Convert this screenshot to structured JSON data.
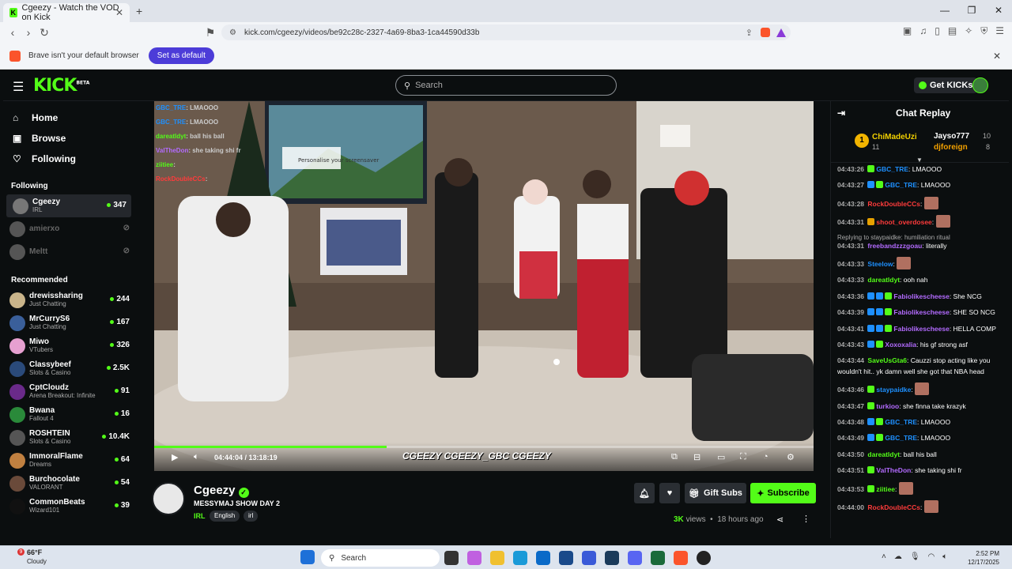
{
  "browser": {
    "tab_title": "Cgeezy - Watch the VOD on Kick",
    "url": "kick.com/cgeezy/videos/be92c28c-2327-4a69-8ba3-1ca44590d33b",
    "infobar_text": "Brave isn't your default browser",
    "infobar_button": "Set as default"
  },
  "header": {
    "logo": "KICK",
    "logo_badge": "BETA",
    "search_placeholder": "Search",
    "get_kicks": "Get KICKs"
  },
  "sidebar": {
    "nav": [
      {
        "label": "Home",
        "icon": "home-icon"
      },
      {
        "label": "Browse",
        "icon": "browse-icon"
      },
      {
        "label": "Following",
        "icon": "heart-icon"
      }
    ],
    "following_title": "Following",
    "following": [
      {
        "name": "Cgeezy",
        "category": "IRL",
        "viewers": "347",
        "live": true,
        "color": "#777"
      },
      {
        "name": "amierxo",
        "category": "",
        "viewers": "",
        "live": false,
        "color": "#555"
      },
      {
        "name": "Meltt",
        "category": "",
        "viewers": "",
        "live": false,
        "color": "#555"
      }
    ],
    "recommended_title": "Recommended",
    "recommended": [
      {
        "name": "drewissharing",
        "category": "Just Chatting",
        "viewers": "244",
        "color": "#c9b48a"
      },
      {
        "name": "MrCurryS6",
        "category": "Just Chatting",
        "viewers": "167",
        "color": "#3a5f9a"
      },
      {
        "name": "Miwo",
        "category": "VTubers",
        "viewers": "326",
        "color": "#e6a0d0"
      },
      {
        "name": "Classybeef",
        "category": "Slots & Casino",
        "viewers": "2.5K",
        "color": "#2a4a7a"
      },
      {
        "name": "CptCloudz",
        "category": "Arena Breakout: Infinite",
        "viewers": "91",
        "color": "#6a2a8a"
      },
      {
        "name": "Bwana",
        "category": "Fallout 4",
        "viewers": "16",
        "color": "#2a8a3a"
      },
      {
        "name": "ROSHTEIN",
        "category": "Slots & Casino",
        "viewers": "10.4K",
        "color": "#555"
      },
      {
        "name": "ImmoralFlame",
        "category": "Dreams",
        "viewers": "64",
        "color": "#c08040"
      },
      {
        "name": "Burchocolate",
        "category": "VALORANT",
        "viewers": "54",
        "color": "#6a4a3a"
      },
      {
        "name": "CommonBeats",
        "category": "Wizard101",
        "viewers": "39",
        "color": "#111"
      }
    ]
  },
  "player": {
    "current_time": "04:44:04",
    "duration": "13:18:19",
    "progress": 0.352,
    "watermark": "CGEEZY  CGEEZY_GBC  CGEEZY",
    "overlay_chat": [
      {
        "user": "GBC_TRE",
        "msg": "LMAOOO"
      },
      {
        "user": "GBC_TRE",
        "msg": "LMAOOO"
      },
      {
        "user": "dareatldyt",
        "msg": "ball his ball"
      },
      {
        "user": "ValTheDon",
        "msg": "she taking shi fr"
      },
      {
        "user": "ziitiee",
        "msg": ""
      },
      {
        "user": "RockDoubleCCs",
        "msg": ""
      }
    ],
    "screen_text": "Personalise your screensaver"
  },
  "stream_info": {
    "channel": "Cgeezy",
    "title": "MESSYMAJ SHOW DAY 2",
    "category": "IRL",
    "tags": [
      "English",
      "irl"
    ],
    "gift_subs": "Gift Subs",
    "subscribe": "Subscribe",
    "views_count": "3K",
    "views_label": "views",
    "time_ago": "18 hours ago"
  },
  "chat": {
    "title": "Chat Replay",
    "leaderboard": [
      {
        "rank": "1",
        "name": "ChiMadeUzi",
        "count": "11"
      },
      {
        "name": "Jayso777",
        "count": "10"
      },
      {
        "name": "djforeign",
        "count": "8"
      }
    ],
    "messages": [
      {
        "ts": "04:43:26",
        "user": "GBC_TRE",
        "color": "#1e90ff",
        "msg": ": LMAOOO",
        "badges": [
          "#53fc18"
        ]
      },
      {
        "ts": "04:43:27",
        "user": "GBC_TRE",
        "color": "#1e90ff",
        "msg": ": LMAOOO",
        "badges": [
          "#1e90ff",
          "#53fc18"
        ]
      },
      {
        "ts": "04:43:28",
        "user": "RockDoubleCCs",
        "color": "#ff3b3b",
        "msg": ":",
        "badges": [],
        "emote": true
      },
      {
        "ts": "04:43:31",
        "user": "shoot_overdosee",
        "color": "#ff3b3b",
        "msg": ":",
        "badges": [
          "#e6a000"
        ],
        "emote": true
      },
      {
        "ts": "04:43:31",
        "user": "freebandzzzgoau",
        "color": "#b36bff",
        "msg": ": literally",
        "badges": [],
        "reply": "Replying to staypaidke: humiliation ritual"
      },
      {
        "ts": "04:43:33",
        "user": "Steelow",
        "color": "#1e90ff",
        "msg": ":",
        "badges": [],
        "emote": true
      },
      {
        "ts": "04:43:33",
        "user": "dareatldyt",
        "color": "#53fc18",
        "msg": ": ooh nah",
        "badges": []
      },
      {
        "ts": "04:43:36",
        "user": "Fabiolikescheese",
        "color": "#b36bff",
        "msg": ": She NCG",
        "badges": [
          "#1e90ff",
          "#1e90ff",
          "#53fc18"
        ]
      },
      {
        "ts": "04:43:39",
        "user": "Fabiolikescheese",
        "color": "#b36bff",
        "msg": ": SHE SO NCG",
        "badges": [
          "#1e90ff",
          "#1e90ff",
          "#53fc18"
        ]
      },
      {
        "ts": "04:43:41",
        "user": "Fabiolikescheese",
        "color": "#b36bff",
        "msg": ": HELLA COMP",
        "badges": [
          "#1e90ff",
          "#1e90ff",
          "#53fc18"
        ]
      },
      {
        "ts": "04:43:43",
        "user": "Xoxoxalia",
        "color": "#b36bff",
        "msg": ": his gf strong asf",
        "badges": [
          "#1e90ff",
          "#53fc18"
        ]
      },
      {
        "ts": "04:43:44",
        "user": "SaveUsGta6",
        "color": "#53fc18",
        "msg": ": Cauzzi stop acting like you wouldn't hit.. yk damn well she got that NBA head",
        "badges": []
      },
      {
        "ts": "04:43:46",
        "user": "staypaidke",
        "color": "#1e90ff",
        "msg": ":",
        "badges": [
          "#53fc18"
        ],
        "emote": true
      },
      {
        "ts": "04:43:47",
        "user": "turkioo",
        "color": "#b36bff",
        "msg": ": she finna take krazyk",
        "badges": [
          "#53fc18"
        ]
      },
      {
        "ts": "04:43:48",
        "user": "GBC_TRE",
        "color": "#1e90ff",
        "msg": ": LMAOOO",
        "badges": [
          "#1e90ff",
          "#53fc18"
        ]
      },
      {
        "ts": "04:43:49",
        "user": "GBC_TRE",
        "color": "#1e90ff",
        "msg": ": LMAOOO",
        "badges": [
          "#1e90ff",
          "#53fc18"
        ]
      },
      {
        "ts": "04:43:50",
        "user": "dareatldyt",
        "color": "#53fc18",
        "msg": ": ball his ball",
        "badges": []
      },
      {
        "ts": "04:43:51",
        "user": "ValTheDon",
        "color": "#b36bff",
        "msg": ": she taking shi fr",
        "badges": [
          "#53fc18"
        ]
      },
      {
        "ts": "04:43:53",
        "user": "ziitiee",
        "color": "#53fc18",
        "msg": ":",
        "badges": [
          "#53fc18"
        ],
        "emote": true
      },
      {
        "ts": "04:44:00",
        "user": "RockDoubleCCs",
        "color": "#ff3b3b",
        "msg": ":",
        "badges": [],
        "emote": true
      }
    ]
  },
  "taskbar": {
    "temp": "66°F",
    "weather": "Cloudy",
    "weather_badge": "9",
    "search": "Search",
    "time": "2:52 PM",
    "date": "12/17/2025"
  }
}
